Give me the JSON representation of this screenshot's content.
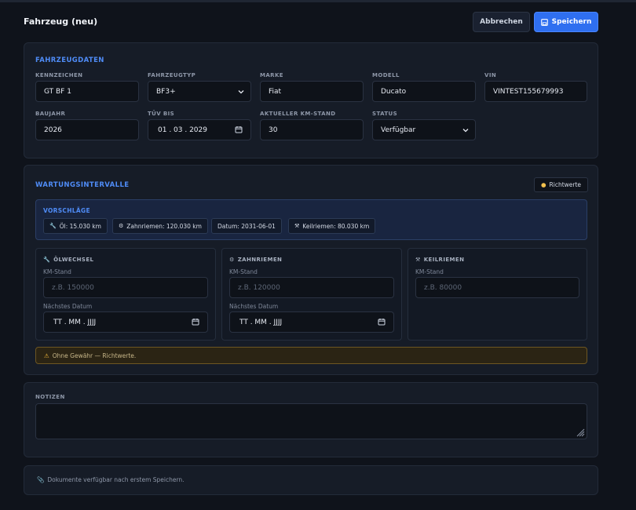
{
  "header": {
    "title": "Fahrzeug (neu)",
    "cancel_label": "Abbrechen",
    "save_label": "Speichern"
  },
  "vehicle": {
    "section_title": "FAHRZEUGDATEN",
    "fields": {
      "kennzeichen": {
        "label": "KENNZEICHEN",
        "value": "GT BF 1"
      },
      "fahrzeugtyp": {
        "label": "FAHRZEUGTYP",
        "value": "BF3+"
      },
      "marke": {
        "label": "MARKE",
        "value": "Fiat"
      },
      "modell": {
        "label": "MODELL",
        "value": "Ducato"
      },
      "vin": {
        "label": "VIN",
        "value": "VINTEST155679993"
      },
      "baujahr": {
        "label": "BAUJAHR",
        "value": "2026"
      },
      "tuev": {
        "label": "TÜV BIS",
        "value": "01 . 03 . 2029"
      },
      "km": {
        "label": "AKTUELLER KM-STAND",
        "value": "30"
      },
      "status": {
        "label": "STATUS",
        "value": "Verfügbar"
      }
    }
  },
  "maintenance": {
    "section_title": "WARTUNGSINTERVALLE",
    "richtwerte_label": "Richtwerte",
    "suggestions_title": "VORSCHLÄGE",
    "suggestions": [
      {
        "icon": "wrench-icon",
        "label": "Öl: 15.030 km"
      },
      {
        "icon": "gear-icon",
        "label": "Zahnriemen: 120.030 km"
      },
      {
        "icon": "",
        "label": "Datum: 2031-06-01"
      },
      {
        "icon": "tools-icon",
        "label": "Keilriemen: 80.030 km"
      }
    ],
    "intervals": {
      "oel": {
        "title": "ÖLWECHSEL",
        "km_label": "KM-Stand",
        "km_placeholder": "z.B. 150000",
        "date_label": "Nächstes Datum",
        "date_placeholder": "TT . MM . JJJJ"
      },
      "zahnriemen": {
        "title": "ZAHNRIEMEN",
        "km_label": "KM-Stand",
        "km_placeholder": "z.B. 120000",
        "date_label": "Nächstes Datum",
        "date_placeholder": "TT . MM . JJJJ"
      },
      "keilriemen": {
        "title": "KEILRIEMEN",
        "km_label": "KM-Stand",
        "km_placeholder": "z.B. 80000"
      }
    },
    "warning": "Ohne Gewähr — Richtwerte."
  },
  "notes": {
    "label": "NOTIZEN",
    "value": ""
  },
  "documents": {
    "note": "Dokumente verfügbar nach erstem Speichern."
  },
  "colors": {
    "accent": "#2f6ff0",
    "section_title": "#4f8cf7",
    "background": "#0f131b",
    "card": "#161c27",
    "warning": "#f2b93b"
  }
}
